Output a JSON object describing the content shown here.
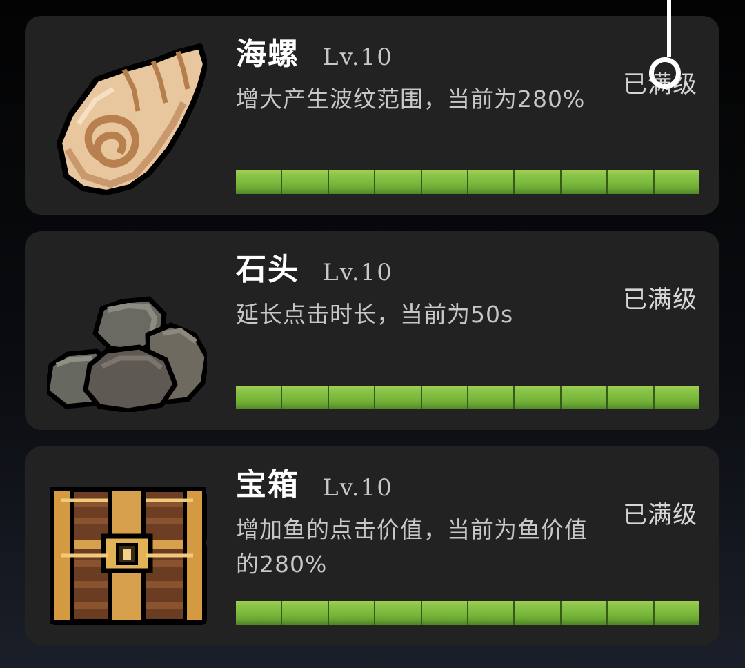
{
  "items": [
    {
      "name": "海螺",
      "level": "Lv.10",
      "description": "增大产生波纹范围，当前为280%",
      "status": "已满级",
      "icon": "conch-shell-icon",
      "progress_segments": 10,
      "progress_filled": 10
    },
    {
      "name": "石头",
      "level": "Lv.10",
      "description": "延长点击时长，当前为50s",
      "status": "已满级",
      "icon": "rock-pile-icon",
      "progress_segments": 10,
      "progress_filled": 10
    },
    {
      "name": "宝箱",
      "level": "Lv.10",
      "description": "增加鱼的点击价值，当前为鱼价值的280%",
      "status": "已满级",
      "icon": "treasure-chest-icon",
      "progress_segments": 10,
      "progress_filled": 10
    }
  ],
  "colors": {
    "card_bg": "#222222",
    "progress_fill": "#8bc34a",
    "title_text": "#ffffff",
    "secondary_text": "#c7c7c7"
  }
}
